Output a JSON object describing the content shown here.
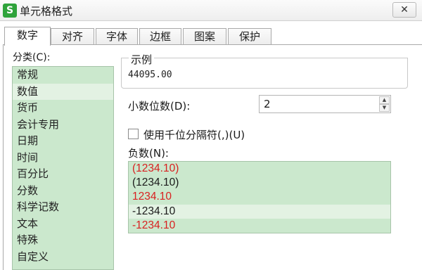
{
  "window": {
    "title": "单元格格式",
    "app_icon_letter": "S",
    "close_symbol": "✕"
  },
  "tabs": [
    {
      "label": "数字",
      "active": true
    },
    {
      "label": "对齐",
      "active": false
    },
    {
      "label": "字体",
      "active": false
    },
    {
      "label": "边框",
      "active": false
    },
    {
      "label": "图案",
      "active": false
    },
    {
      "label": "保护",
      "active": false
    }
  ],
  "category": {
    "label": "分类(C):",
    "selected_index": 1,
    "items": [
      "常规",
      "数值",
      "货币",
      "会计专用",
      "日期",
      "时间",
      "百分比",
      "分数",
      "科学记数",
      "文本",
      "特殊",
      "自定义"
    ]
  },
  "sample": {
    "title": "示例",
    "value": "44095.00"
  },
  "decimal_places": {
    "label": "小数位数(D):",
    "value": "2",
    "up_symbol": "▲",
    "down_symbol": "▼"
  },
  "thousands_separator": {
    "label": "使用千位分隔符(,)(U)",
    "checked": false
  },
  "negative_numbers": {
    "label": "负数(N):",
    "selected_index": 3,
    "items": [
      {
        "text": "(1234.10)",
        "color": "#d92020"
      },
      {
        "text": "(1234.10)",
        "color": "#1a1a1a"
      },
      {
        "text": "1234.10",
        "color": "#d92020"
      },
      {
        "text": "-1234.10",
        "color": "#1a1a1a"
      },
      {
        "text": "-1234.10",
        "color": "#d92020"
      }
    ]
  },
  "colors": {
    "list_bg": "#cbe8cd",
    "list_selected": "#e3f2e3",
    "negative_red": "#d92020"
  }
}
